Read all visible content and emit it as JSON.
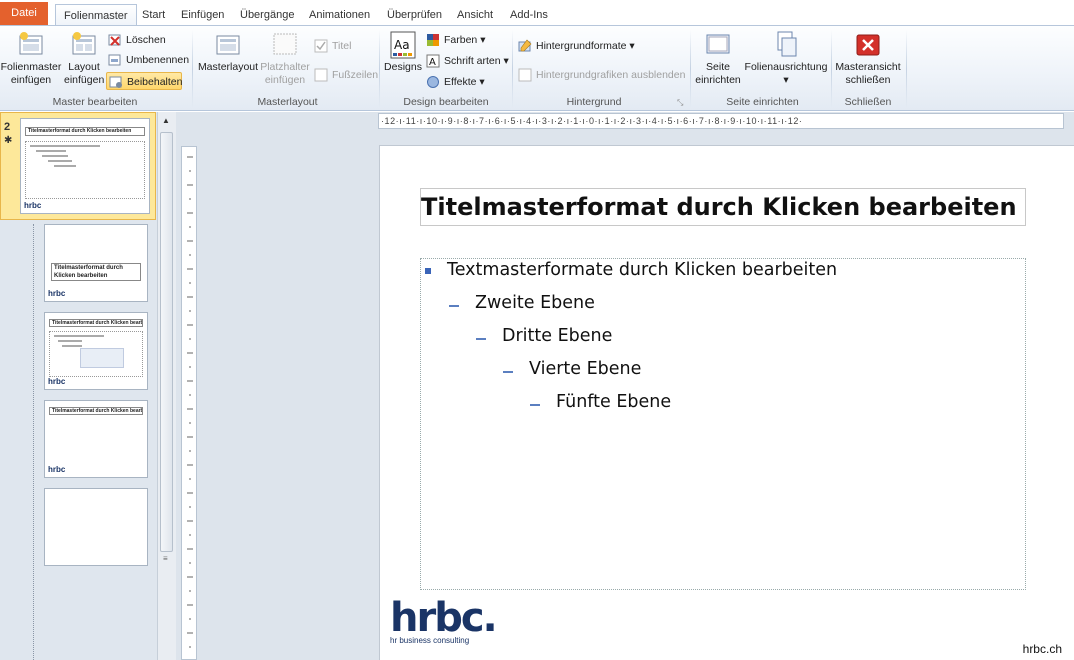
{
  "tabs": [
    {
      "label": "Datei"
    },
    {
      "label": "Folienmaster"
    },
    {
      "label": "Start"
    },
    {
      "label": "Einfügen"
    },
    {
      "label": "Übergänge"
    },
    {
      "label": "Animationen"
    },
    {
      "label": "Überprüfen"
    },
    {
      "label": "Ansicht"
    },
    {
      "label": "Add-Ins"
    }
  ],
  "ribbon": {
    "master_bearbeiten": {
      "label": "Master bearbeiten",
      "folienmaster_line1": "Folienmaster",
      "folienmaster_line2": "einfügen",
      "layout_line1": "Layout",
      "layout_line2": "einfügen",
      "loeschen": "Löschen",
      "umbenennen": "Umbenennen",
      "beibehalten": "Beibehalten"
    },
    "masterlayout": {
      "label": "Masterlayout",
      "masterlayout_btn": "Masterlayout",
      "platzhalter_line1": "Platzhalter",
      "platzhalter_line2": "einfügen",
      "titel": "Titel",
      "fusszeilen": "Fußzeilen"
    },
    "design": {
      "label": "Design bearbeiten",
      "designs": "Designs",
      "farben": "Farben",
      "schriftarten": "Schrift arten",
      "effekte": "Effekte"
    },
    "hintergrund": {
      "label": "Hintergrund",
      "formate": "Hintergrundformate",
      "ausblenden": "Hintergrundgrafiken ausblenden"
    },
    "seite": {
      "label": "Seite einrichten",
      "seite_line1": "Seite",
      "seite_line2": "einrichten",
      "ausrichtung": "Folienausrichtung"
    },
    "schliessen": {
      "label": "Schließen",
      "line1": "Masteransicht",
      "line2": "schließen"
    }
  },
  "thumbnails": {
    "selected_number": "2",
    "items": [
      {
        "title": "Titelmasterformat durch Klicken bearbeiten"
      },
      {
        "title": "Titelmasterformat durch Klicken bearbeiten"
      },
      {
        "title": "Titelmasterformat durch Klicken bearbeiten"
      },
      {
        "title": "Titelmasterformat durch Klicken bearbeiten"
      },
      {
        "title": ""
      }
    ],
    "logo": "hrbc"
  },
  "ruler": {
    "horizontal": "·12·ı·11·ı·10·ı·9·ı·8·ı·7·ı·6·ı·5·ı·4·ı·3·ı·2·ı·1·ı·0·ı·1·ı·2·ı·3·ı·4·ı·5·ı·6·ı·7·ı·8·ı·9·ı·10·ı·11·ı·12·"
  },
  "slide": {
    "title": "Titelmasterformat durch Klicken bearbeiten",
    "levels": [
      "Textmasterformate durch Klicken bearbeiten",
      "Zweite Ebene",
      "Dritte Ebene",
      "Vierte Ebene",
      "Fünfte Ebene"
    ],
    "logo_text": "hrbc.",
    "logo_subtitle": "hr business consulting",
    "url": "hrbc.ch"
  },
  "colors": {
    "file_tab": "#e4612d",
    "accent_blue": "#3a64b8",
    "logo_blue": "#1a3466",
    "highlight": "#ffd66b"
  }
}
